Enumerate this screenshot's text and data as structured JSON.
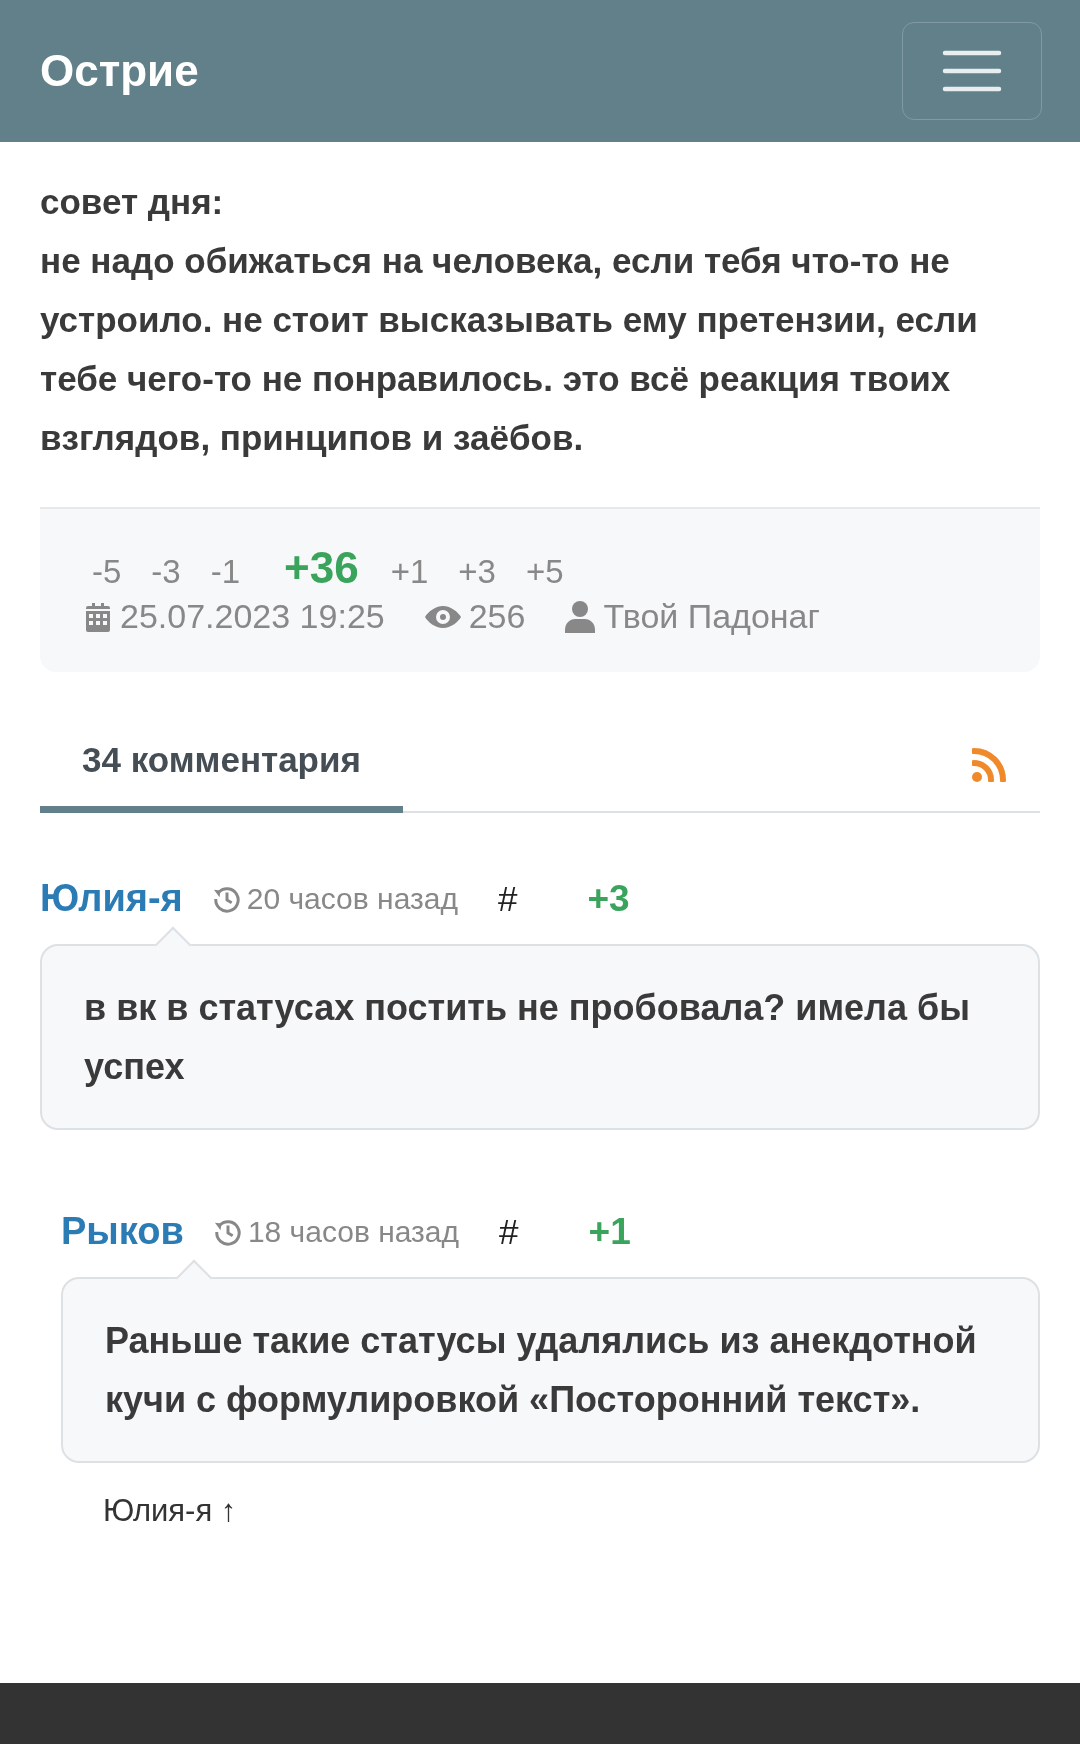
{
  "header": {
    "title": "Острие"
  },
  "post": {
    "text": "совет дня:\nне надо обижаться на человека, если тебя что-то не устроило. не стоит высказывать ему претензии, если тебе чего-то не понравилось. это всё реакция твоих взглядов, принципов и заёбов."
  },
  "stats": {
    "votes": [
      {
        "label": "-5",
        "kind": "vote"
      },
      {
        "label": "-3",
        "kind": "vote"
      },
      {
        "label": "-1",
        "kind": "vote"
      },
      {
        "label": "+36",
        "kind": "score"
      },
      {
        "label": "+1",
        "kind": "vote"
      },
      {
        "label": "+3",
        "kind": "vote"
      },
      {
        "label": "+5",
        "kind": "vote"
      }
    ],
    "date": "25.07.2023 19:25",
    "views": "256",
    "author": "Твой Падонаг"
  },
  "tabs": [
    {
      "label": "34 комментария",
      "selected": true
    }
  ],
  "comments": [
    {
      "author": "Юлия-я",
      "time": "20 часов назад",
      "anchor": "#",
      "rating": "+3",
      "text": "в вк в статусах постить не пробовала? имела бы успех",
      "children": [
        {
          "author": "Рыков",
          "time": "18 часов назад",
          "anchor": "#",
          "rating": "+1",
          "text": "Раньше такие статусы удалялись из анекдотной кучи с формулировкой «Посторонний текст».",
          "reply_to": "Юлия-я ↑"
        }
      ]
    }
  ]
}
